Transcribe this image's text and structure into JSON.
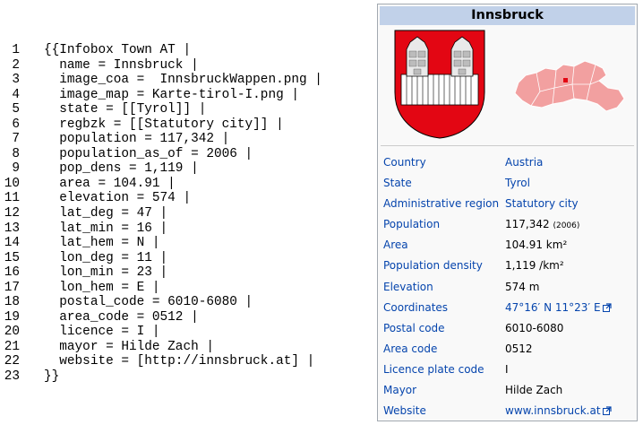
{
  "code_lines": [
    {
      "n": "1",
      "text": "{{Infobox Town AT |"
    },
    {
      "n": "2",
      "text": "  name = Innsbruck |"
    },
    {
      "n": "3",
      "text": "  image_coa =  InnsbruckWappen.png |"
    },
    {
      "n": "4",
      "text": "  image_map = Karte-tirol-I.png |"
    },
    {
      "n": "5",
      "text": "  state = [[Tyrol]] |"
    },
    {
      "n": "6",
      "text": "  regbzk = [[Statutory city]] |"
    },
    {
      "n": "7",
      "text": "  population = 117,342 |"
    },
    {
      "n": "8",
      "text": "  population_as_of = 2006 |"
    },
    {
      "n": "9",
      "text": "  pop_dens = 1,119 |"
    },
    {
      "n": "10",
      "text": "  area = 104.91 |"
    },
    {
      "n": "11",
      "text": "  elevation = 574 |"
    },
    {
      "n": "12",
      "text": "  lat_deg = 47 |"
    },
    {
      "n": "13",
      "text": "  lat_min = 16 |"
    },
    {
      "n": "14",
      "text": "  lat_hem = N |"
    },
    {
      "n": "15",
      "text": "  lon_deg = 11 |"
    },
    {
      "n": "16",
      "text": "  lon_min = 23 |"
    },
    {
      "n": "17",
      "text": "  lon_hem = E |"
    },
    {
      "n": "18",
      "text": "  postal_code = 6010-6080 |"
    },
    {
      "n": "19",
      "text": "  area_code = 0512 |"
    },
    {
      "n": "20",
      "text": "  licence = I |"
    },
    {
      "n": "21",
      "text": "  mayor = Hilde Zach |"
    },
    {
      "n": "22",
      "text": "  website = [http://innsbruck.at] |"
    },
    {
      "n": "23",
      "text": "}}"
    }
  ],
  "infobox": {
    "title": "Innsbruck",
    "rows": [
      {
        "label": "Country",
        "value": "Austria",
        "link": true
      },
      {
        "label": "State",
        "value": "Tyrol",
        "link": true
      },
      {
        "label": "Administrative region",
        "value": "Statutory city",
        "link": true
      },
      {
        "label": "Population",
        "value": "117,342",
        "note": "(2006)",
        "link": false
      },
      {
        "label": "Area",
        "value": "104.91 km²",
        "link": false
      },
      {
        "label": "Population density",
        "value": "1,119 /km²",
        "link": false
      },
      {
        "label": "Elevation",
        "value": "574 m",
        "link": false
      },
      {
        "label": "Coordinates",
        "value": "47°16′ N 11°23′ E",
        "link": true,
        "external": true
      },
      {
        "label": "Postal code",
        "value": "6010-6080",
        "link": false
      },
      {
        "label": "Area code",
        "value": "0512",
        "link": false
      },
      {
        "label": "Licence plate code",
        "value": "I",
        "link": false
      },
      {
        "label": "Mayor",
        "value": "Hilde Zach",
        "link": false
      },
      {
        "label": "Website",
        "value": "www.innsbruck.at",
        "link": true,
        "external": true
      }
    ]
  },
  "colors": {
    "title_bg": "#c1d1e9",
    "link": "#0645ad",
    "coa_red": "#e30613",
    "map_fill": "#f2a0a0",
    "map_mark": "#e30613"
  }
}
